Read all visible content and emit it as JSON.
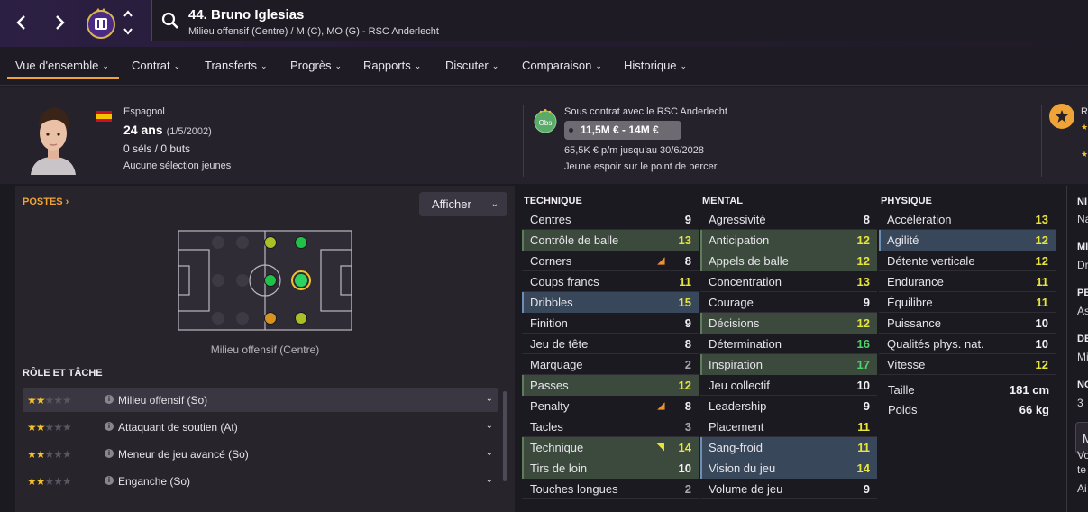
{
  "colors": {
    "accent": "#f0a336",
    "highlight_yellow": "#e7e43e",
    "highlight_green": "#4ed36a",
    "row_green": "#3c4a3d",
    "row_blue": "#38485a"
  },
  "header": {
    "player_title": "44. Bruno Iglesias",
    "player_subtitle": "Milieu offensif (Centre) / M (C), MO (G) - RSC Anderlecht"
  },
  "tabs": [
    {
      "label": "Vue d'ensemble",
      "active": true
    },
    {
      "label": "Contrat"
    },
    {
      "label": "Transferts"
    },
    {
      "label": "Progrès"
    },
    {
      "label": "Rapports"
    },
    {
      "label": "Discuter"
    },
    {
      "label": "Comparaison"
    },
    {
      "label": "Historique"
    }
  ],
  "profile": {
    "nationality": "Espagnol",
    "age": "24 ans",
    "dob": "(1/5/2002)",
    "caps": "0 séls / 0 buts",
    "youth_caps": "Aucune sélection jeunes"
  },
  "contract": {
    "badge": "Obs",
    "status": "Sous contrat avec le RSC Anderlecht",
    "value": "11,5M € - 14M €",
    "wage": "65,5K € p/m jusqu'au 30/6/2028",
    "tag": "Jeune espoir sur le point de percer"
  },
  "right_edge_profile": {
    "label_cut": "R"
  },
  "positions": {
    "title": "POSTES",
    "show_button": "Afficher",
    "position_label": "Milieu offensif (Centre)"
  },
  "roles": {
    "title": "RÔLE ET TÂCHE",
    "items": [
      {
        "stars": 2,
        "name": "Milieu offensif (So)",
        "selected": true
      },
      {
        "stars": 2,
        "name": "Attaquant de soutien (At)"
      },
      {
        "stars": 2,
        "name": "Meneur de jeu avancé (So)"
      },
      {
        "stars": 2,
        "name": "Enganche (So)"
      }
    ]
  },
  "attributes": {
    "technique": {
      "title": "TECHNIQUE",
      "rows": [
        {
          "name": "Centres",
          "value": "9",
          "hl": "none",
          "tone": "white"
        },
        {
          "name": "Contrôle de balle",
          "value": "13",
          "hl": "green",
          "tone": "yellow"
        },
        {
          "name": "Corners",
          "value": "8",
          "hl": "none",
          "tone": "white",
          "trend": "down"
        },
        {
          "name": "Coups francs",
          "value": "11",
          "hl": "none",
          "tone": "yellow"
        },
        {
          "name": "Dribbles",
          "value": "15",
          "hl": "blue",
          "tone": "yellow"
        },
        {
          "name": "Finition",
          "value": "9",
          "hl": "none",
          "tone": "white"
        },
        {
          "name": "Jeu de tête",
          "value": "8",
          "hl": "none",
          "tone": "white"
        },
        {
          "name": "Marquage",
          "value": "2",
          "hl": "none",
          "tone": "grey"
        },
        {
          "name": "Passes",
          "value": "12",
          "hl": "green",
          "tone": "yellow"
        },
        {
          "name": "Penalty",
          "value": "8",
          "hl": "none",
          "tone": "white",
          "trend": "down"
        },
        {
          "name": "Tacles",
          "value": "3",
          "hl": "none",
          "tone": "grey"
        },
        {
          "name": "Technique",
          "value": "14",
          "hl": "green",
          "tone": "yellow",
          "trend": "up"
        },
        {
          "name": "Tirs de loin",
          "value": "10",
          "hl": "green",
          "tone": "white"
        },
        {
          "name": "Touches longues",
          "value": "2",
          "hl": "none",
          "tone": "grey"
        }
      ]
    },
    "mental": {
      "title": "MENTAL",
      "rows": [
        {
          "name": "Agressivité",
          "value": "8",
          "hl": "none",
          "tone": "white"
        },
        {
          "name": "Anticipation",
          "value": "12",
          "hl": "green",
          "tone": "yellow"
        },
        {
          "name": "Appels de balle",
          "value": "12",
          "hl": "green",
          "tone": "yellow"
        },
        {
          "name": "Concentration",
          "value": "13",
          "hl": "none",
          "tone": "yellow"
        },
        {
          "name": "Courage",
          "value": "9",
          "hl": "none",
          "tone": "white"
        },
        {
          "name": "Décisions",
          "value": "12",
          "hl": "green",
          "tone": "yellow"
        },
        {
          "name": "Détermination",
          "value": "16",
          "hl": "none",
          "tone": "green"
        },
        {
          "name": "Inspiration",
          "value": "17",
          "hl": "green",
          "tone": "green"
        },
        {
          "name": "Jeu collectif",
          "value": "10",
          "hl": "none",
          "tone": "white"
        },
        {
          "name": "Leadership",
          "value": "9",
          "hl": "none",
          "tone": "white"
        },
        {
          "name": "Placement",
          "value": "11",
          "hl": "none",
          "tone": "yellow"
        },
        {
          "name": "Sang-froid",
          "value": "11",
          "hl": "blue",
          "tone": "yellow"
        },
        {
          "name": "Vision du jeu",
          "value": "14",
          "hl": "blue",
          "tone": "yellow"
        },
        {
          "name": "Volume de jeu",
          "value": "9",
          "hl": "none",
          "tone": "white"
        }
      ]
    },
    "physique": {
      "title": "PHYSIQUE",
      "rows": [
        {
          "name": "Accélération",
          "value": "13",
          "hl": "none",
          "tone": "yellow"
        },
        {
          "name": "Agilité",
          "value": "12",
          "hl": "blue",
          "tone": "yellow"
        },
        {
          "name": "Détente verticale",
          "value": "12",
          "hl": "none",
          "tone": "yellow"
        },
        {
          "name": "Endurance",
          "value": "11",
          "hl": "none",
          "tone": "yellow"
        },
        {
          "name": "Équilibre",
          "value": "11",
          "hl": "none",
          "tone": "yellow"
        },
        {
          "name": "Puissance",
          "value": "10",
          "hl": "none",
          "tone": "white"
        },
        {
          "name": "Qualités phys. nat.",
          "value": "10",
          "hl": "none",
          "tone": "white"
        },
        {
          "name": "Vitesse",
          "value": "12",
          "hl": "none",
          "tone": "yellow"
        }
      ],
      "height_label": "Taille",
      "height": "181 cm",
      "weight_label": "Poids",
      "weight": "66 kg"
    }
  },
  "right_panel": {
    "h1": "NI",
    "t1": "Na",
    "h2": "MI",
    "t2": "Dr",
    "h3": "PE",
    "t3": "As",
    "h4": "DE",
    "t4": "Mi",
    "h5": "NO",
    "t5": "3",
    "btn": "M",
    "t6": "Vo",
    "t7": "te",
    "t8": "Ai"
  }
}
